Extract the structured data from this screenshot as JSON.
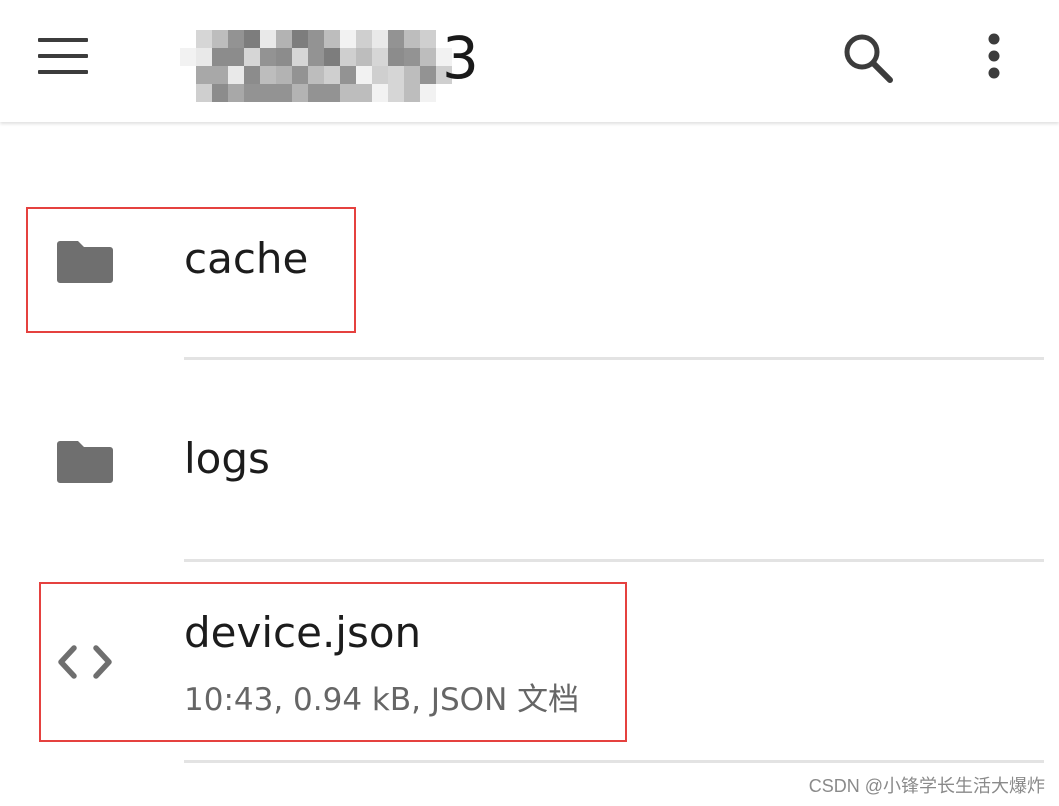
{
  "appbar": {
    "menu_icon": "menu-icon",
    "title": "3",
    "search_icon": "search-icon",
    "more_icon": "more-vert-icon"
  },
  "files": [
    {
      "name": "cache",
      "icon": "folder-icon",
      "meta": ""
    },
    {
      "name": "logs",
      "icon": "folder-icon",
      "meta": ""
    },
    {
      "name": "device.json",
      "icon": "code-icon",
      "meta": "10:43, 0.94 kB, JSON 文档"
    }
  ],
  "watermark": "CSDN @小锋学长生活大爆炸",
  "colors": {
    "highlight": "#e5413f",
    "icon_gray": "#6f6f6f",
    "divider": "#e3e3e3"
  }
}
